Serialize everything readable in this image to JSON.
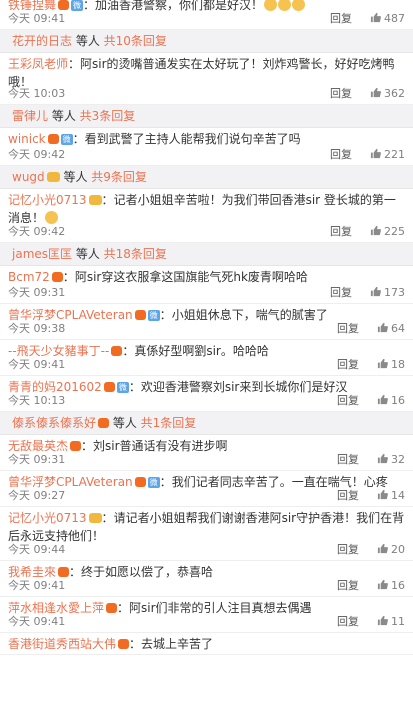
{
  "reply_label": "回复",
  "comments": [
    {
      "user": "铁锤捏舞",
      "badge": "orange",
      "tag": "微",
      "text": "加油香港警察，你们都是好汉！",
      "emoji": 3,
      "time": "今天 09:41",
      "likes": "487",
      "h": 36,
      "first": true
    },
    {
      "type": "sub",
      "user": "花开的日志",
      "mid": "等人",
      "count": "共10条回复",
      "h": 24
    },
    {
      "user": "王彩凤老师",
      "text": "阿sir的烫嘴普通发实在太好玩了！刘炸鸡警长，好好吃烤鸭哦！",
      "time": "今天 10:03",
      "likes": "362",
      "h": 52
    },
    {
      "type": "sub",
      "user": "雷律儿",
      "mid": "等人",
      "count": "共3条回复",
      "h": 24
    },
    {
      "user": "winick",
      "badge": "orange",
      "tag": "微",
      "text": "看到武警了主持人能帮我们说句辛苦了吗",
      "time": "今天 09:42",
      "likes": "221",
      "h": 38
    },
    {
      "type": "sub",
      "user": "wugd",
      "badge": "yellow",
      "mid": "等人",
      "count": "共9条回复",
      "h": 24
    },
    {
      "user": "记忆小光0713",
      "badge": "yellow",
      "text": "记者小姐姐辛苦啦！为我们带回香港sir 登长城的第一消息！",
      "emoji": 1,
      "time": "今天 09:42",
      "likes": "225",
      "h": 54
    },
    {
      "type": "sub",
      "user": "james匡匡",
      "mid": "等人",
      "count": "共18条回复",
      "h": 24
    },
    {
      "user": "Bcm72",
      "badge": "orange",
      "text": "阿sir穿这衣服拿这国旗能气死hk废青啊哈哈",
      "time": "今天 09:31",
      "likes": "173",
      "h": 38
    },
    {
      "user": "曾华浮梦CPLAVeteran",
      "badge": "orange",
      "tag": "微",
      "text": "小姐姐休息下，喘气的腻害了",
      "time": "今天 09:38",
      "likes": "64",
      "h": 36
    },
    {
      "user": "--飛天少女豬事丁--",
      "badge": "orange",
      "text": "真係好型啊劉sir。哈哈哈",
      "time": "今天 09:41",
      "likes": "18",
      "h": 36
    },
    {
      "user": "青青的妈201602",
      "badge": "orange",
      "tag": "微",
      "text": "欢迎香港警察刘sir来到长城你们是好汉",
      "time": "今天 10:13",
      "likes": "16",
      "h": 36
    },
    {
      "type": "sub",
      "user": "傣系傣系傣系好",
      "badge": "orange",
      "mid": "等人",
      "count": "共1条回复",
      "h": 24
    },
    {
      "user": "无敌最英杰",
      "badge": "orange",
      "text": "刘sir普通话有没有进步啊",
      "time": "今天 09:31",
      "likes": "32",
      "h": 36
    },
    {
      "user": "曾华浮梦CPLAVeteran",
      "badge": "orange",
      "tag": "微",
      "text": "我们记者同志辛苦了。一直在喘气！心疼",
      "time": "今天 09:27",
      "likes": "14",
      "h": 36
    },
    {
      "user": "记忆小光0713",
      "badge": "yellow",
      "text": "请记者小姐姐帮我们谢谢香港阿sir守护香港！我们在背后永远支持他们！",
      "time": "今天 09:44",
      "likes": "20",
      "h": 54
    },
    {
      "user": "我希圭來",
      "badge": "orange",
      "text": "终于如愿以偿了，恭喜哈",
      "time": "今天 09:41",
      "likes": "16",
      "h": 36
    },
    {
      "user": "萍水相逢水愛上萍",
      "badge": "orange",
      "text": "阿sir们非常的引人注目真想去偶遇",
      "time": "今天 09:41",
      "likes": "11",
      "h": 36
    },
    {
      "user": "香港街道秀西站大伟",
      "badge": "orange",
      "text": "去城上辛苦了",
      "time": "",
      "likes": "",
      "h": 22
    }
  ]
}
